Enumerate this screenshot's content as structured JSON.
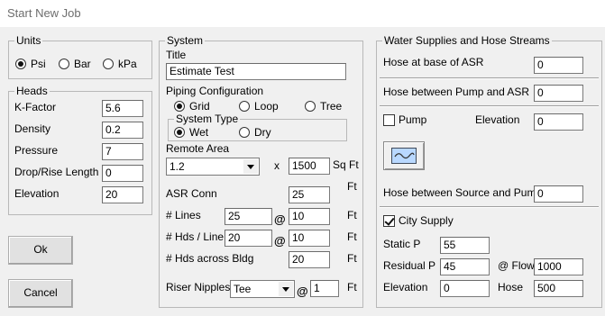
{
  "window": {
    "title": "Start New Job"
  },
  "units": {
    "legend": "Units",
    "options": [
      "Psi",
      "Bar",
      "kPa"
    ],
    "selected": "Psi"
  },
  "heads": {
    "legend": "Heads",
    "k_factor": {
      "label": "K-Factor",
      "value": "5.6"
    },
    "density": {
      "label": "Density",
      "value": "0.2"
    },
    "pressure": {
      "label": "Pressure",
      "value": "7"
    },
    "drop_rise": {
      "label": "Drop/Rise Length",
      "value": "0"
    },
    "elevation": {
      "label": "Elevation",
      "value": "20"
    }
  },
  "buttons": {
    "ok": "Ok",
    "cancel": "Cancel"
  },
  "system": {
    "legend": "System",
    "title_label": "Title",
    "title_value": "Estimate Test",
    "piping_label": "Piping Configuration",
    "piping_options": [
      "Grid",
      "Loop",
      "Tree"
    ],
    "piping_selected": "Grid",
    "system_type_legend": "System Type",
    "system_type_options": [
      "Wet",
      "Dry"
    ],
    "system_type_selected": "Wet",
    "remote_area_label": "Remote Area",
    "remote_area_select": "1.2",
    "times": "x",
    "remote_area_value": "1500",
    "remote_area_unit": "Sq Ft",
    "asr_conn_label": "ASR Conn",
    "asr_conn_value": "25",
    "asr_conn_unit": "Ft",
    "lines_label": "# Lines",
    "lines_value": "25",
    "lines_at": "@",
    "lines_spacing": "10",
    "lines_unit": "Ft",
    "hds_line_label": "# Hds / Line",
    "hds_line_value": "20",
    "hds_line_at": "@",
    "hds_line_spacing": "10",
    "hds_line_unit": "Ft",
    "hds_bldg_label": "# Hds across Bldg",
    "hds_bldg_value": "20",
    "hds_bldg_unit": "Ft",
    "riser_label": "Riser Nipples",
    "riser_select": "Tee",
    "riser_at": "@",
    "riser_value": "1",
    "riser_unit": "Ft"
  },
  "water": {
    "legend": "Water Supplies and Hose Streams",
    "hose_base_asr_label": "Hose at base of ASR",
    "hose_base_asr_value": "0",
    "hose_pump_asr_label": "Hose between Pump and ASR",
    "hose_pump_asr_value": "0",
    "pump_label": "Pump",
    "pump_checked": false,
    "elevation_label": "Elevation",
    "elevation_value": "0",
    "hose_source_pump_label": "Hose between Source and Pump",
    "hose_source_pump_value": "0",
    "city_supply_label": "City Supply",
    "city_supply_checked": true,
    "static_label": "Static P",
    "static_value": "55",
    "residual_label": "Residual P",
    "residual_value": "45",
    "flow_label": "@ Flow",
    "flow_value": "1000",
    "city_elev_label": "Elevation",
    "city_elev_value": "0",
    "hose_label": "Hose",
    "hose_value": "500"
  }
}
